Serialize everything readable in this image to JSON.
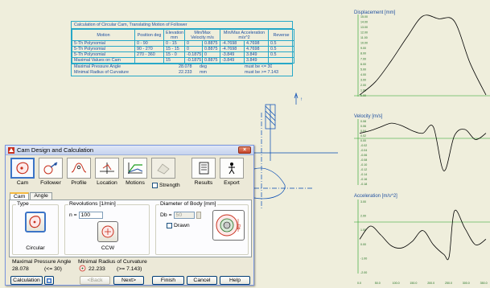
{
  "table": {
    "title": "Calculation of Circular Cam, Translating Motion of Follower",
    "headers": [
      "Motion",
      "Position deg",
      "Elevation mm",
      "Min/Max Velocity m/s",
      "Min/Max Acceleration m/s^2",
      "Reverse"
    ],
    "rows": [
      [
        "5-Th Polynomial",
        "0 - 90",
        "0 - 15",
        "0",
        "0.8875",
        "-4.7698",
        "4.7698",
        "0.5"
      ],
      [
        "5-Th Polynomial",
        "90 - 270",
        "15 - 15",
        "0",
        "0.8875",
        "-4.7698",
        "4.7698",
        "0.5"
      ],
      [
        "5-Th Polynomial",
        "270 - 360",
        "15 - 0",
        "-0.1875",
        "0",
        "-3.849",
        "3.849",
        "0.5"
      ],
      [
        "Maximal Values on Cam",
        "",
        "15",
        "-0.1875",
        "0.8875",
        "-3.849",
        "3.849",
        ""
      ]
    ],
    "summary": [
      {
        "label": "Maximal Pressure Angle",
        "value": "28.078",
        "unit": "deg",
        "note": "must be <= 30"
      },
      {
        "label": "Minimal Radius of Curvature",
        "value": "22.233",
        "unit": "mm",
        "note": "must be >= 7.143"
      }
    ]
  },
  "graphs": {
    "displacement": {
      "title": "Displacement [mm]"
    },
    "velocity": {
      "title": "Velocity [m/s]"
    },
    "acceleration": {
      "title": "Acceleration [m/s^2]"
    }
  },
  "chart_data": [
    {
      "type": "line",
      "title": "Displacement [mm]",
      "x": [
        0,
        45,
        90,
        135,
        180,
        225,
        270,
        315,
        360
      ],
      "y": [
        0,
        2.5,
        6.5,
        11,
        15,
        14.5,
        14,
        6,
        0
      ],
      "ylim": [
        0,
        15
      ],
      "y_ticks": [
        "15.00",
        "14.00",
        "13.00",
        "12.00",
        "11.00",
        "10.00",
        "9.00",
        "8.00",
        "7.00",
        "6.00",
        "5.00",
        "4.00",
        "3.00",
        "2.00",
        "1.00",
        "0.00"
      ],
      "x_ticks": [
        "0.0",
        "50.0",
        "100.0",
        "150.0",
        "200.0",
        "250.0",
        "300.0",
        "350.0"
      ],
      "color": "#000000"
    },
    {
      "type": "line",
      "title": "Velocity [m/s]",
      "x": [
        0,
        30,
        60,
        90,
        120,
        150,
        180,
        210,
        240,
        270,
        300,
        330,
        360
      ],
      "y": [
        0,
        0.02,
        0.05,
        0.08,
        0.06,
        0.02,
        0,
        0.05,
        -0.3,
        -0.02,
        0.03,
        -0.05,
        0
      ],
      "ylim": [
        -0.4,
        0.1
      ],
      "y_ticks": [
        "0.08",
        "0.06",
        "0.04",
        "0.02",
        "0.00",
        "-0.02",
        "-0.04",
        "-0.06",
        "-0.08",
        "-0.10",
        "-0.12",
        "-0.14",
        "-0.16",
        "-0.18"
      ],
      "color": "#000000"
    },
    {
      "type": "line",
      "title": "Acceleration [m/s^2]",
      "x": [
        0,
        30,
        60,
        90,
        120,
        150,
        180,
        210,
        240,
        255,
        270,
        300,
        330,
        360
      ],
      "y": [
        0,
        1.2,
        0.4,
        -0.6,
        -0.8,
        -0.2,
        0.8,
        -0.5,
        -1.4,
        -1.6,
        2.6,
        1.0,
        -0.5,
        0
      ],
      "ylim": [
        -3,
        3.5
      ],
      "y_ticks": [
        "3.00",
        "2.00",
        "1.00",
        "0.00",
        "-1.00",
        "-2.00"
      ],
      "x_ticks": [
        "0.0",
        "50.0",
        "100.0",
        "150.0",
        "200.0",
        "250.0",
        "300.0",
        "350.0"
      ],
      "color": "#000000"
    }
  ],
  "dialog": {
    "title": "Cam Design and Calculation",
    "close_glyph": "×",
    "toolbar": [
      {
        "label": "Cam",
        "icon": "cam-icon",
        "active": true
      },
      {
        "label": "Follower",
        "icon": "follower-icon"
      },
      {
        "label": "Profile",
        "icon": "profile-icon"
      },
      {
        "label": "Location",
        "icon": "location-icon"
      },
      {
        "label": "Motions",
        "icon": "motions-icon"
      },
      {
        "label": "Strength",
        "icon": "strength-icon",
        "disabled": true
      },
      {
        "label": "Results",
        "icon": "results-icon"
      },
      {
        "label": "Export",
        "icon": "export-icon"
      }
    ],
    "strength_label": "Strength",
    "tabs": [
      "Cam",
      "Angle"
    ],
    "type_group": {
      "title": "Type",
      "selected": "Circular"
    },
    "revolutions": {
      "title": "Revolutions [1/min]",
      "prefix": "n =",
      "value": "100",
      "direction": "CCW"
    },
    "diameter": {
      "title": "Diameter of Body [mm]",
      "prefix": "Db =",
      "value": "50",
      "drawn_label": "Drawn",
      "dim_label": "Db"
    },
    "pressure": {
      "label": "Maximal Pressure Angle",
      "value": "28.078",
      "limit": "(<= 30)"
    },
    "curvature": {
      "label": "Minimal Radius of Curvature",
      "value": "22.233",
      "limit": "(>= 7.143)"
    },
    "buttons": {
      "calculation": "Calculation",
      "back": "<Back",
      "next": "Next>",
      "finish": "Finish",
      "cancel": "Cancel",
      "help": "Help"
    }
  },
  "colors": {
    "background": "#efeedc",
    "table_border": "#27a8c8",
    "curve_grid": "#1f9f1f",
    "accent": "#3b74c7"
  }
}
